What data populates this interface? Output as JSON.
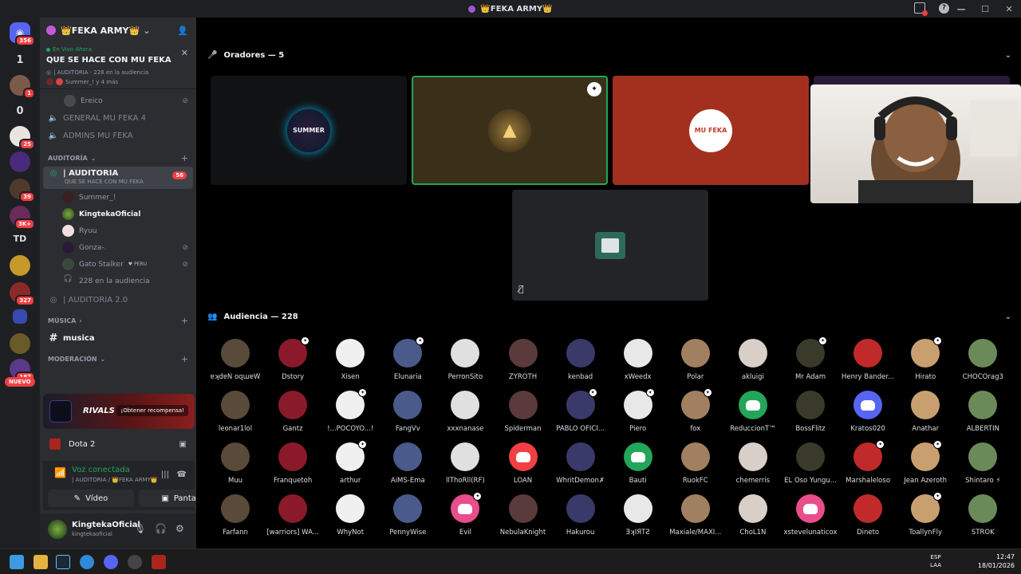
{
  "window": {
    "title": "👑FEKA ARMY👑"
  },
  "server_rail": {
    "badges": [
      "356",
      "1",
      "0",
      "25",
      "39",
      "3K+",
      "327",
      "187"
    ],
    "text_items": [
      "1",
      "0",
      "TD"
    ],
    "new_pill": "NUEVO"
  },
  "sidebar": {
    "guild_name": "👑FEKA ARMY👑",
    "live": {
      "label": "En Vivo Ahora",
      "title": "QUE SE HACE CON MU FEKA",
      "meta": "| AUDITORIA · 228 en la audiencia",
      "participants": "Summer_! y 4 más"
    },
    "channels": {
      "ereico": "Ereico",
      "general": "GENERAL MU FEKA 4",
      "admins": "ADMINS MU FEKA",
      "cat_auditoria": "AUDITORÍA",
      "auditoria": "| AUDITORIA",
      "auditoria_sub": "QUE SE HACE CON MU FEKA",
      "auditoria_badge": "56",
      "users": [
        "Summer_!",
        "KingtekaOficial",
        "Ryuu",
        "Gonza-.",
        "Gato Stalker"
      ],
      "peru_tag": "PERU",
      "audience": "228 en la audiencia",
      "auditoria2": "| AUDITORIA 2.0",
      "cat_musica": "MÚSICA",
      "musica": "musica",
      "cat_moderacion": "MODERACIÓN"
    },
    "promo": {
      "logo": "RIVALS",
      "button": "¡Obtener recompensa!"
    },
    "game": {
      "name": "Dota 2"
    },
    "voice": {
      "status": "Voz conectada",
      "sub": "| AUDITORIA / 👑FEKA ARMY👑",
      "video_label": "Vídeo",
      "screen_label": "Pantalla"
    },
    "user": {
      "name": "KingtekaOficial",
      "handle": "kingtekaoficial"
    }
  },
  "stage": {
    "speakers_header": "Oradores — 5",
    "audience_header": "Audiencia — 228",
    "speaker_labels": [
      "SUMMER",
      "MU FEKA"
    ]
  },
  "audience": [
    "ɐʞdɐN oqɯɐW",
    "Dstory",
    "Xisen",
    "Elunaria",
    "PerronSito",
    "ZYROTH",
    "kenbad",
    "xWeedx",
    "Polar",
    "akluigi",
    "Mr Adam",
    "Henry Bander...",
    "Hirato",
    "CHOCOrag3",
    "leonar1lol",
    "Gantz",
    "!...POCOYO...!",
    "FangVv",
    "xxxnanase",
    "Spiderman",
    "PABLO OFICI...",
    "Piero",
    "fox",
    "ReduccionT™",
    "BossFlitz",
    "Kratos020",
    "Anathar",
    "ALBERTIN",
    "Muu",
    "Franquetoh",
    "arthur",
    "AiMS-Ema",
    "llThoRll(RF)",
    "LOAN",
    "WhritDemon✗",
    "Bauti",
    "RuokFC",
    "chemerris",
    "EL Oso Yungu...",
    "Marshaleloso",
    "Jean Azeroth",
    "Shintaro ⚡",
    "Farfann",
    "[warriors] WA...",
    "WhyNot",
    "PennyWise",
    "Evil",
    "NebulaKnight",
    "Hakurou",
    "ƎʞIЯTƧ",
    "Maxiale/MAXI...",
    "ChoL1N",
    "xstevelunaticox",
    "Dineto",
    "ToallynFly",
    "STROK"
  ],
  "taskbar": {
    "lang1": "ESP",
    "lang2": "LAA",
    "time": "12:47",
    "date": "18/01/2026"
  },
  "colors": {
    "green": "#23a55a",
    "red": "#f23f43",
    "blurple": "#5865f2",
    "sidebar": "#2b2d31"
  }
}
